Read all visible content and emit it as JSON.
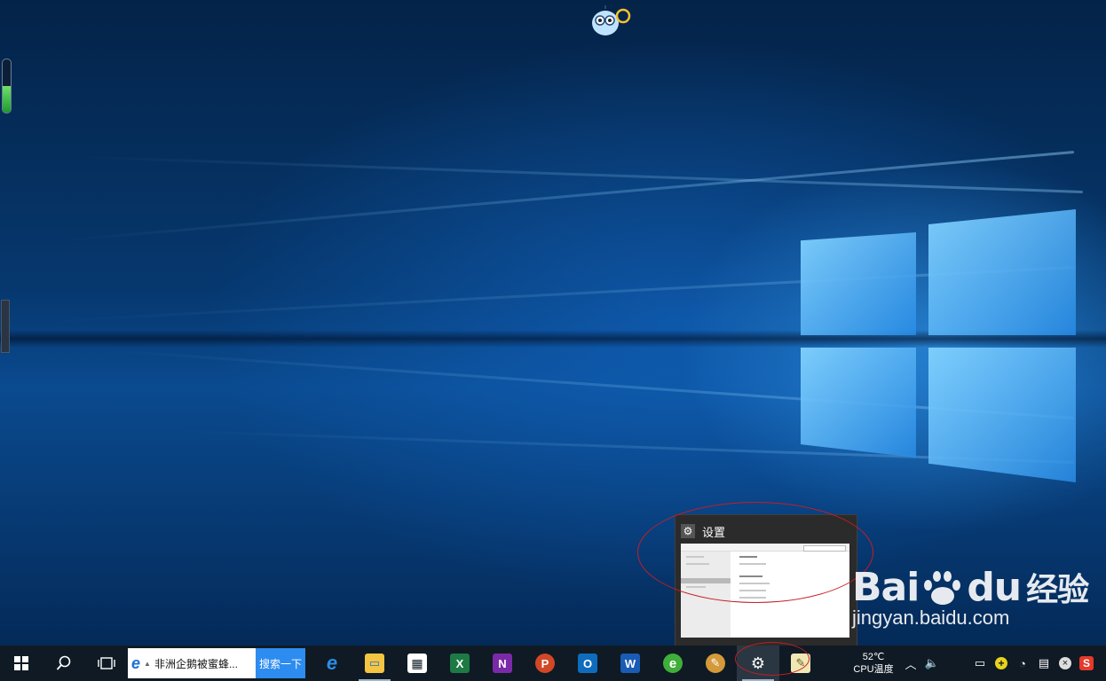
{
  "preview": {
    "title": "设置"
  },
  "watermark": {
    "brand_latin": "Bai",
    "brand_du": "du",
    "brand_cn": "经验",
    "url": "jingyan.baidu.com"
  },
  "taskbar": {
    "search_text": "非洲企鹅被蜜蜂...",
    "search_button": "搜索一下",
    "temperature": "52℃",
    "temperature_label": "CPU温度",
    "apps": [
      {
        "name": "edge",
        "color": "#1e6fd6",
        "glyph": "e"
      },
      {
        "name": "file-explorer",
        "color": "#f4c542",
        "glyph": "▭"
      },
      {
        "name": "store",
        "color": "#ffffff",
        "glyph": "▦"
      },
      {
        "name": "excel",
        "color": "#1d7a45",
        "glyph": "X"
      },
      {
        "name": "onenote",
        "color": "#7a2aa8",
        "glyph": "N"
      },
      {
        "name": "powerpoint",
        "color": "#d24726",
        "glyph": "P"
      },
      {
        "name": "outlook",
        "color": "#0f6cbd",
        "glyph": "O"
      },
      {
        "name": "word",
        "color": "#1a5bb5",
        "glyph": "W"
      },
      {
        "name": "browser",
        "color": "#3fae3a",
        "glyph": "e"
      },
      {
        "name": "paint",
        "color": "#d49a3a",
        "glyph": "✎"
      },
      {
        "name": "settings",
        "color": "#3a3a3a",
        "glyph": "⚙"
      },
      {
        "name": "sticky-notes",
        "color": "#f1e7b5",
        "glyph": "✎"
      }
    ]
  },
  "colors": {
    "annotation": "#c41e24",
    "taskbar": "#0f1a24",
    "search_button": "#2d8cf0"
  }
}
